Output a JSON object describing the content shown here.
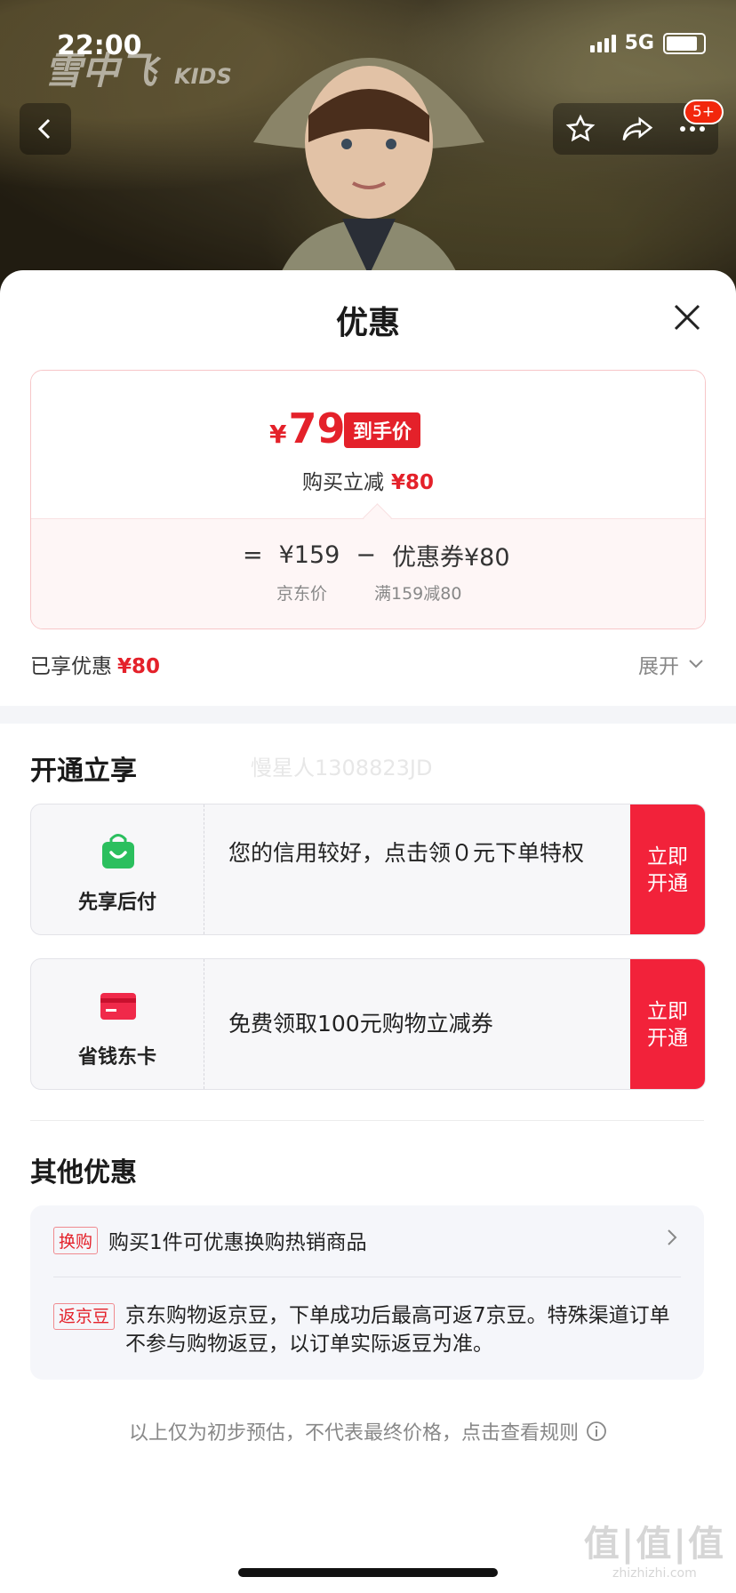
{
  "status_bar": {
    "time": "22:00",
    "network": "5G"
  },
  "header": {
    "brand": "雪中飞",
    "brand_sub": "KIDS",
    "badge": "5+"
  },
  "sheet": {
    "title": "优惠",
    "price": {
      "symbol": "¥",
      "amount": "79",
      "tag": "到手价",
      "instant_label": "购买立减",
      "instant_value": "¥80",
      "calc_equals": "=",
      "jd_price": "¥159",
      "minus": "−",
      "coupon": "优惠券¥80",
      "jd_price_label": "京东价",
      "coupon_rule": "满159减80"
    },
    "enjoyed_label": "已享优惠",
    "enjoyed_value": "¥80",
    "expand_label": "展开"
  },
  "open_section": {
    "title": "开通立享",
    "watermark": "慢星人1308823JD",
    "offers": [
      {
        "name": "先享后付",
        "text": "您的信用较好，点击领０元下单特权",
        "button": "立即开通",
        "icon": "shopping-bag-icon",
        "color": "#2bbf5e"
      },
      {
        "name": "省钱东卡",
        "text": "免费领取100元购物立减券",
        "button": "立即开通",
        "icon": "card-icon",
        "color": "#f0294a"
      }
    ]
  },
  "other_section": {
    "title": "其他优惠",
    "items": [
      {
        "tag": "换购",
        "text": "购买1件可优惠换购热销商品"
      },
      {
        "tag": "返京豆",
        "text": "京东购物返京豆，下单成功后最高可返7京豆。特殊渠道订单不参与购物返豆，以订单实际返豆为准。"
      }
    ]
  },
  "footnote": "以上仅为初步预估，不代表最终价格，点击查看规则",
  "site_watermark": {
    "main": "值|值|值",
    "sub": "zhizhizhi.com"
  }
}
